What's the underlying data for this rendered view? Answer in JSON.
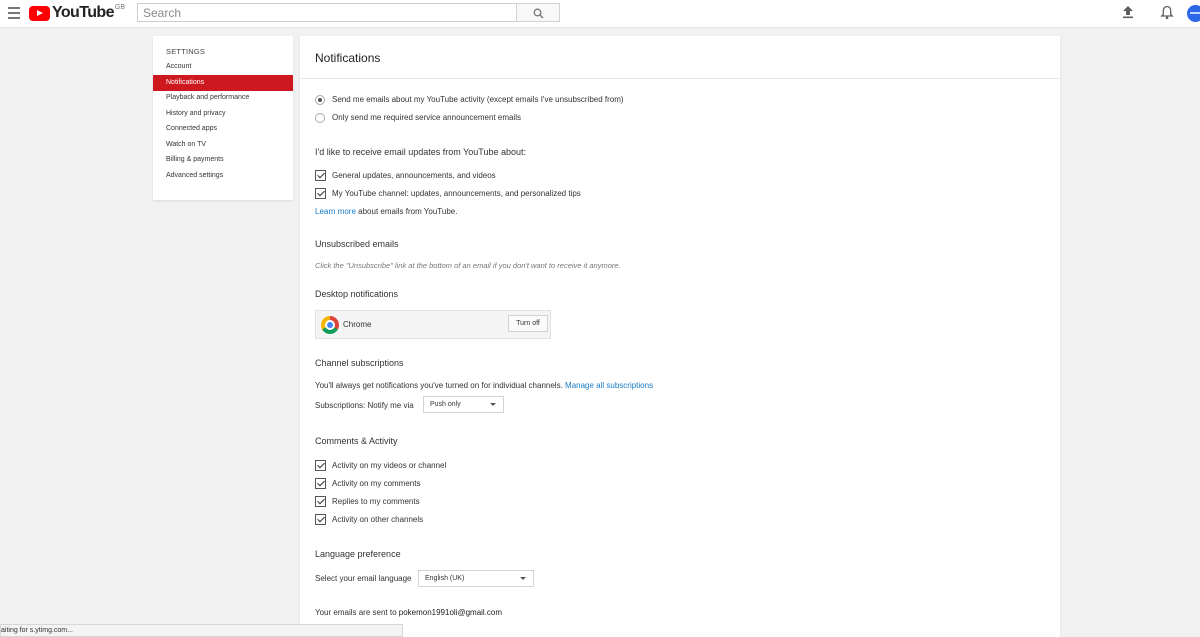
{
  "header": {
    "logo_text": "YouTube",
    "logo_region": "GB",
    "search_placeholder": "Search"
  },
  "sidebar": {
    "heading": "SETTINGS",
    "items": [
      {
        "label": "Account",
        "active": false
      },
      {
        "label": "Notifications",
        "active": true
      },
      {
        "label": "Playback and performance",
        "active": false
      },
      {
        "label": "History and privacy",
        "active": false
      },
      {
        "label": "Connected apps",
        "active": false
      },
      {
        "label": "Watch on TV",
        "active": false
      },
      {
        "label": "Billing & payments",
        "active": false
      },
      {
        "label": "Advanced settings",
        "active": false
      }
    ]
  },
  "main": {
    "title": "Notifications",
    "email_options": [
      {
        "label": "Send me emails about my YouTube activity (except emails I've unsubscribed from)",
        "selected": true
      },
      {
        "label": "Only send me required service announcement emails",
        "selected": false
      }
    ],
    "updates": {
      "title": "I'd like to receive email updates from YouTube about:",
      "items": [
        {
          "label": "General updates, announcements, and videos",
          "checked": true
        },
        {
          "label": "My YouTube channel: updates, announcements, and personalized tips",
          "checked": true
        }
      ],
      "learn_more_link": "Learn more",
      "learn_more_rest": " about emails from YouTube."
    },
    "unsubscribed": {
      "title": "Unsubscribed emails",
      "hint": "Click the \"Unsubscribe\" link at the bottom of an email if you don't want to receive it anymore."
    },
    "desktop": {
      "title": "Desktop notifications",
      "browser": "Chrome",
      "button": "Turn off"
    },
    "channel": {
      "title": "Channel subscriptions",
      "text": "You'll always get notifications you've turned on for individual channels. ",
      "link": "Manage all subscriptions",
      "notify_label": "Subscriptions: Notify me via",
      "notify_value": "Push only"
    },
    "comments": {
      "title": "Comments & Activity",
      "items": [
        {
          "label": "Activity on my videos or channel",
          "checked": true
        },
        {
          "label": "Activity on my comments",
          "checked": true
        },
        {
          "label": "Replies to my comments",
          "checked": true
        },
        {
          "label": "Activity on other channels",
          "checked": true
        }
      ]
    },
    "language": {
      "title": "Language preference",
      "label": "Select your email language",
      "value": "English (UK)"
    },
    "email_sent_label": "Your emails are sent to ",
    "email_address": "pokemon1991oli@gmail.com"
  },
  "status_bar": "aiting for s.ytimg.com..."
}
